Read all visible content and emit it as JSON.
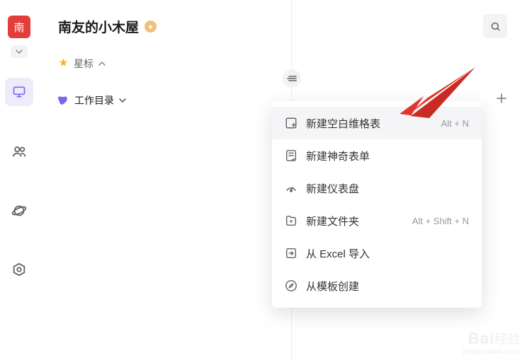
{
  "avatar_char": "南",
  "title": "南友的小木屋",
  "sections": {
    "starred": "星标",
    "workdir": "工作目录"
  },
  "menu": {
    "items": [
      {
        "label": "新建空白维格表",
        "shortcut": "Alt + N"
      },
      {
        "label": "新建神奇表单",
        "shortcut": ""
      },
      {
        "label": "新建仪表盘",
        "shortcut": ""
      },
      {
        "label": "新建文件夹",
        "shortcut": "Alt + Shift + N"
      },
      {
        "label": "从 Excel 导入",
        "shortcut": ""
      },
      {
        "label": "从模板创建",
        "shortcut": ""
      }
    ]
  },
  "watermark": {
    "brand": "Bai",
    "brand2": "经验",
    "url": "jingyan.baidu.com"
  }
}
